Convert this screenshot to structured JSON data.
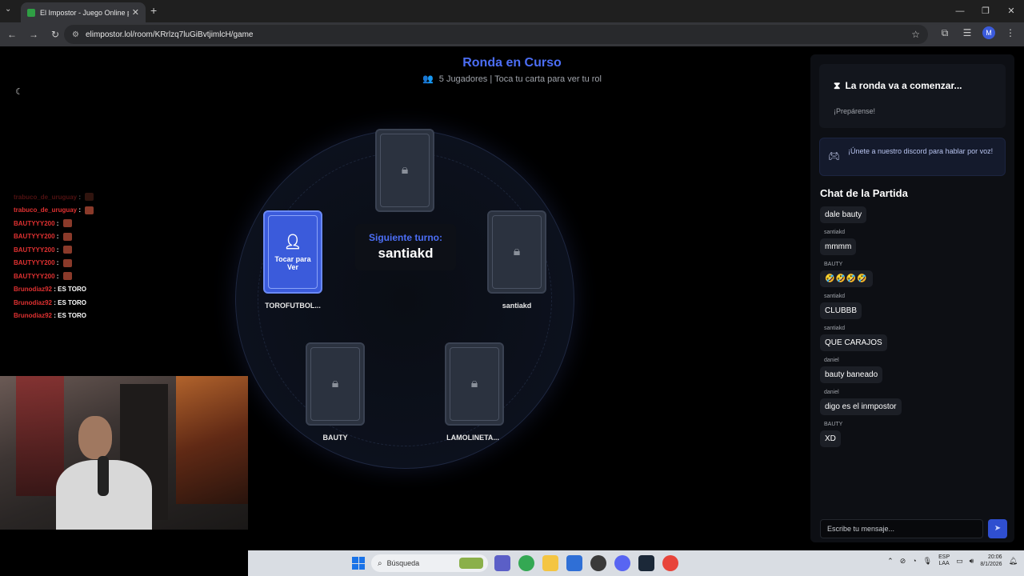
{
  "browser": {
    "tab_title": "El Impostor - Juego Online par",
    "tab_close": "✕",
    "new_tab": "+",
    "url": "elimpostor.lol/room/KRrlzq7luGiBvtjimlcH/game",
    "profile_initial": "M"
  },
  "game": {
    "title": "Ronda en Curso",
    "players_count": "5 Jugadores",
    "subtitle_sep": "|",
    "subtitle_hint": "Toca tu carta para ver tu rol",
    "next_turn_label": "Siguiente turno:",
    "next_turn_player": "santiakd",
    "active_card_label": "Tocar para Ver",
    "players": [
      {
        "name": "",
        "locked": true
      },
      {
        "name": "TOROFUTBOL...",
        "locked": false
      },
      {
        "name": "santiakd",
        "locked": true
      },
      {
        "name": "BAUTY",
        "locked": true
      },
      {
        "name": "LAMOLINETA...",
        "locked": true
      }
    ]
  },
  "stream_chat": [
    {
      "user": "trabuco_de_uruguay",
      "msg": "",
      "emote": true,
      "fade": true
    },
    {
      "user": "trabuco_de_uruguay",
      "msg": "",
      "emote": true,
      "fade": false
    },
    {
      "user": "BAUTYYY200",
      "msg": "",
      "emote": true,
      "fade": false
    },
    {
      "user": "BAUTYYY200",
      "msg": "",
      "emote": true,
      "fade": false
    },
    {
      "user": "BAUTYYY200",
      "msg": "",
      "emote": true,
      "fade": false
    },
    {
      "user": "BAUTYYY200",
      "msg": "",
      "emote": true,
      "fade": false
    },
    {
      "user": "BAUTYYY200",
      "msg": "",
      "emote": true,
      "fade": false
    },
    {
      "user": "Brunodiaz92",
      "msg": "ES TORO",
      "emote": false,
      "fade": false
    },
    {
      "user": "Brunodiaz92",
      "msg": "ES TORO",
      "emote": false,
      "fade": false
    },
    {
      "user": "Brunodiaz92",
      "msg": "ES TORO",
      "emote": false,
      "fade": false
    }
  ],
  "sidebar": {
    "status_title": "La ronda va a comenzar...",
    "status_sub": "¡Prepárense!",
    "discord_text": "¡Únete a nuestro discord para hablar por voz!",
    "chat_title": "Chat de la Partida",
    "messages": [
      {
        "author": "",
        "text": "dale bauty"
      },
      {
        "author": "santiakd",
        "text": "mmmm"
      },
      {
        "author": "BAUTY",
        "text": "🤣🤣🤣🤣"
      },
      {
        "author": "santiakd",
        "text": "CLUBBB"
      },
      {
        "author": "santiakd",
        "text": "QUE CARAJOS"
      },
      {
        "author": "daniel",
        "text": "bauty baneado"
      },
      {
        "author": "daniel",
        "text": "digo es el inmpostor"
      },
      {
        "author": "BAUTY",
        "text": "XD"
      }
    ],
    "input_placeholder": "Escribe tu mensaje..."
  },
  "taskbar": {
    "search_label": "Búsqueda",
    "lang_line1": "ESP",
    "lang_line2": "LAA",
    "time": "20:06",
    "date": "8/1/2026"
  },
  "colors": {
    "accent": "#4c6ef5",
    "card_active": "#3b5bdb",
    "stream_user": "#e03131"
  }
}
